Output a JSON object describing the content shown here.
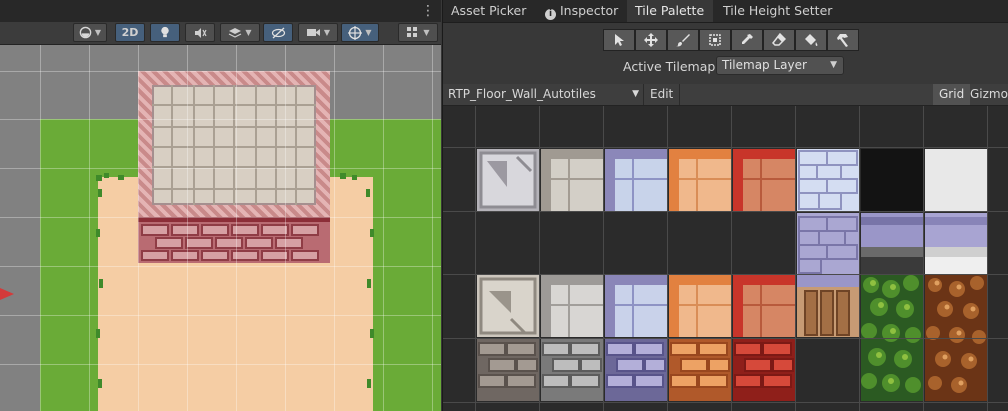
{
  "scene": {
    "toolbar": {
      "mode_2d_label": "2D"
    },
    "menu_glyph": "⋮"
  },
  "panel": {
    "tabs": [
      {
        "label": "Asset Picker",
        "active": false
      },
      {
        "label": "Inspector",
        "active": false,
        "icon": "info-icon"
      },
      {
        "label": "Tile Palette",
        "active": true
      },
      {
        "label": "Tile Height Setter",
        "active": false
      }
    ],
    "tools": [
      {
        "name": "select",
        "icon": "arrow-cursor-icon"
      },
      {
        "name": "move",
        "icon": "move-arrows-icon"
      },
      {
        "name": "paint",
        "icon": "brush-icon"
      },
      {
        "name": "box-fill",
        "icon": "box-select-icon"
      },
      {
        "name": "pick",
        "icon": "eyedropper-icon"
      },
      {
        "name": "erase",
        "icon": "eraser-icon"
      },
      {
        "name": "fill",
        "icon": "paint-bucket-icon"
      },
      {
        "name": "custom",
        "icon": "hammer-icon"
      }
    ],
    "active_tilemap_label": "Active Tilemap",
    "active_tilemap_value": "Tilemap Layer",
    "palette_name": "RTP_Floor_Wall_Autotiles",
    "edit_label": "Edit",
    "grid_label": "Grid",
    "gizmos_label": "Gizmos"
  },
  "colors": {
    "accent_blue": "#46607c",
    "grass": "#6aab37",
    "sand": "#f5cda4",
    "scene_bg": "#818181",
    "palette_bg": "#2b2b2b"
  }
}
